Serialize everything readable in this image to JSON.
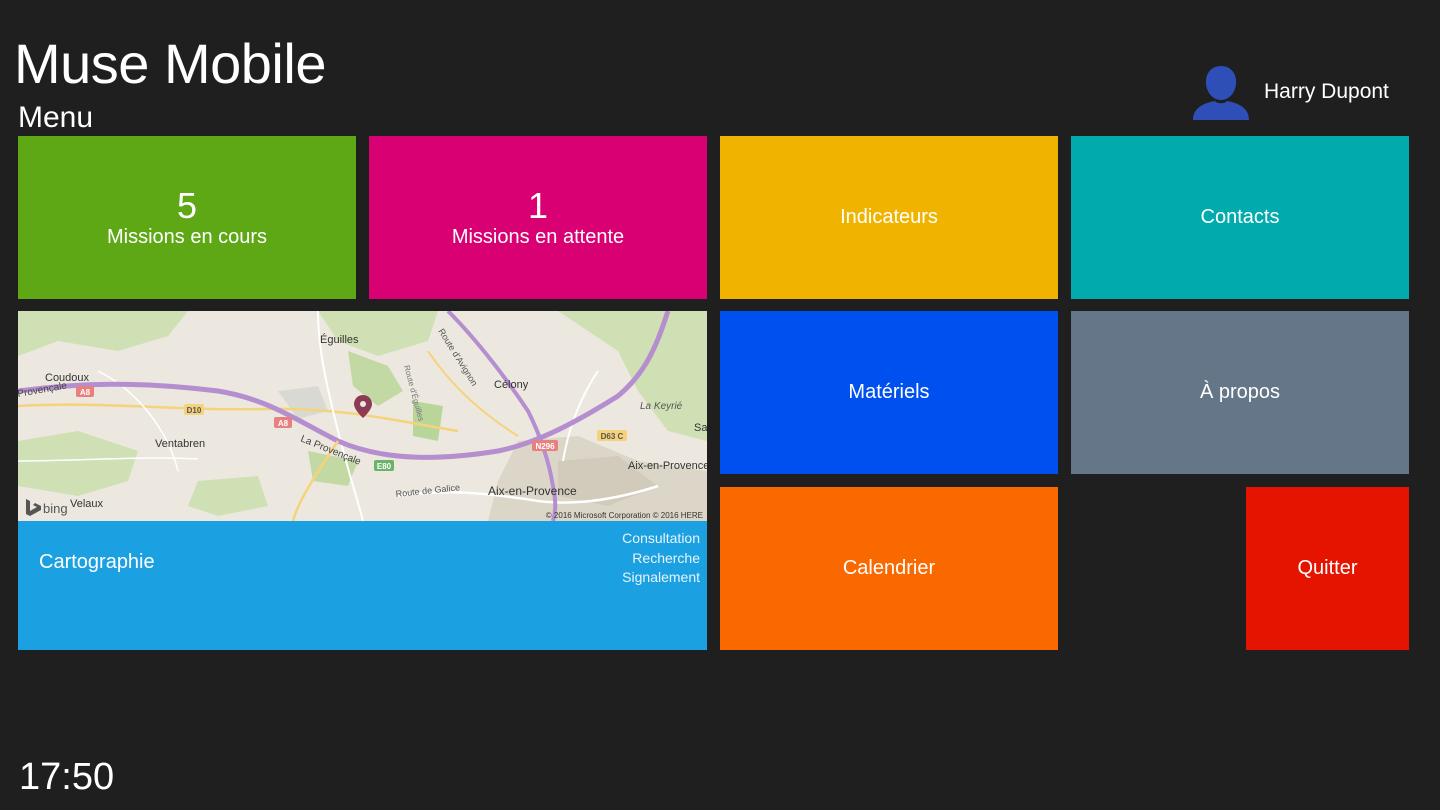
{
  "app": {
    "title": "Muse Mobile",
    "subtitle": "Menu"
  },
  "user": {
    "name": "Harry Dupont",
    "icon": "user-icon"
  },
  "tiles": {
    "missions_en_cours": {
      "count": "5",
      "label": "Missions en cours",
      "color": "#5ea816"
    },
    "missions_en_attente": {
      "count": "1",
      "label": "Missions en attente",
      "color": "#d80073"
    },
    "indicateurs": {
      "label": "Indicateurs",
      "color": "#f0b400"
    },
    "contacts": {
      "label": "Contacts",
      "color": "#00aaad"
    },
    "materiels": {
      "label": "Matériels",
      "color": "#0050ef"
    },
    "a_propos": {
      "label": "À propos",
      "color": "#647687"
    },
    "calendrier": {
      "label": "Calendrier",
      "color": "#fa6800"
    },
    "quitter": {
      "label": "Quitter",
      "color": "#e51400"
    },
    "cartographie": {
      "label": "Cartographie",
      "color": "#1ba1e2",
      "links": [
        "Consultation",
        "Recherche",
        "Signalement"
      ]
    }
  },
  "map": {
    "places": [
      "Éguilles",
      "Coudoux",
      "Célony",
      "Ventabren",
      "La Keyrié",
      "Aix-en-Provence",
      "Aix-en-Provence",
      "Velaux",
      "Sai"
    ],
    "roads": [
      "Route d'Avignon",
      "Route d'Éguilles",
      "Provençale",
      "La Provençale",
      "Route de Galice"
    ],
    "shields": [
      "A8",
      "D10",
      "A8",
      "E80",
      "N296",
      "D63 C"
    ],
    "brand": "bing",
    "attribution": "© 2016 Microsoft Corporation © 2016 HERE"
  },
  "clock": {
    "time": "17:50"
  }
}
